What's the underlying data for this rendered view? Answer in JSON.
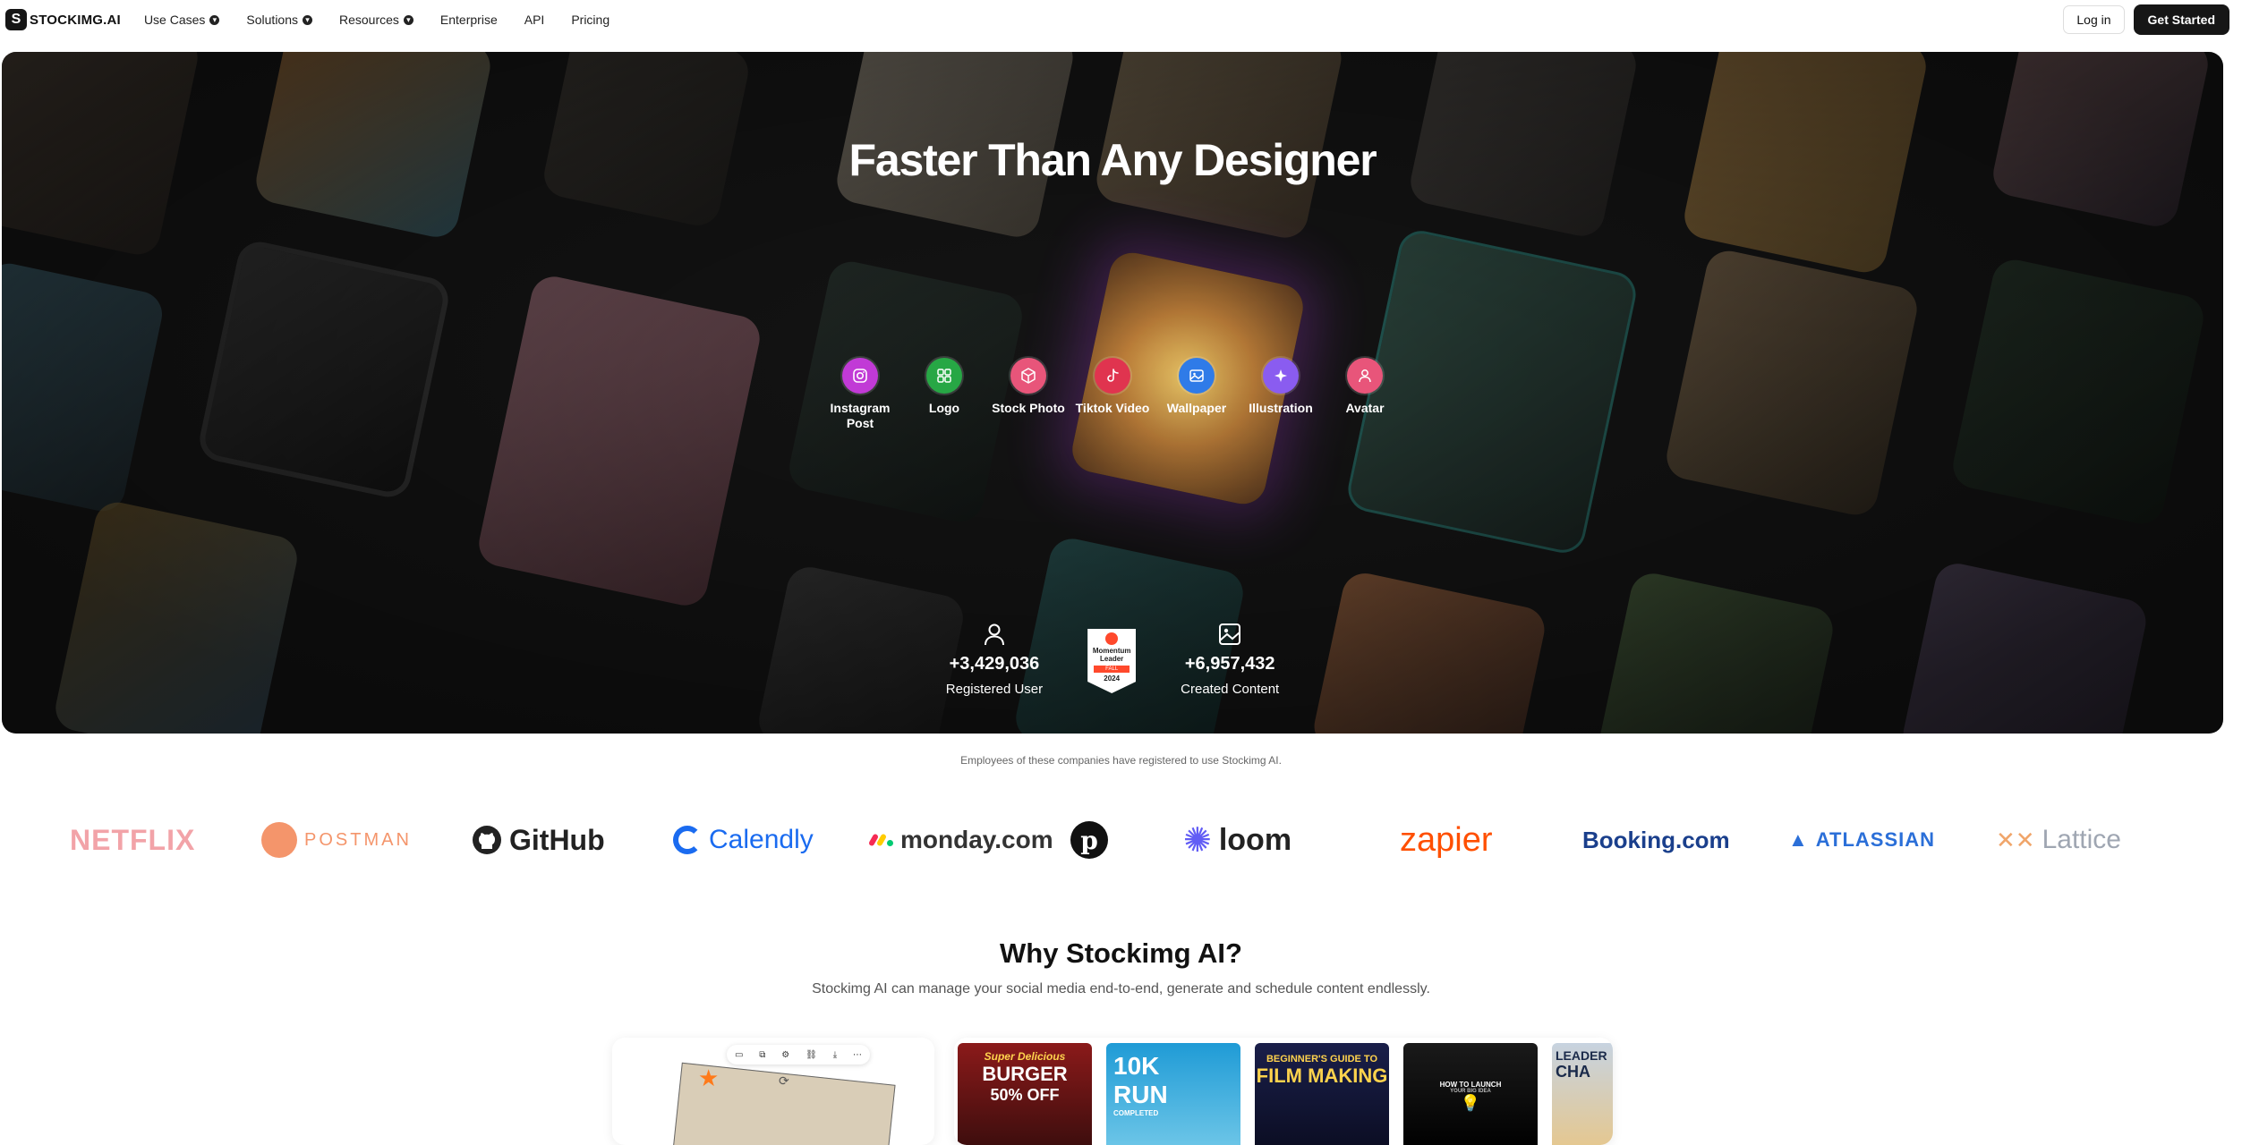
{
  "nav": {
    "logo_text": "STOCKIMG.AI",
    "logo_mark": "S",
    "items": [
      {
        "label": "Use Cases",
        "has_dropdown": true
      },
      {
        "label": "Solutions",
        "has_dropdown": true
      },
      {
        "label": "Resources",
        "has_dropdown": true
      },
      {
        "label": "Enterprise",
        "has_dropdown": false
      },
      {
        "label": "API",
        "has_dropdown": false
      },
      {
        "label": "Pricing",
        "has_dropdown": false
      }
    ],
    "login_label": "Log in",
    "cta_label": "Get Started"
  },
  "hero": {
    "title": "Faster Than Any Designer",
    "categories": [
      {
        "label": "Instagram Post",
        "icon": "instagram-icon",
        "color": "#c13ad6"
      },
      {
        "label": "Logo",
        "icon": "grid-icon",
        "color": "#27a745"
      },
      {
        "label": "Stock Photo",
        "icon": "box-icon",
        "color": "#e8557a"
      },
      {
        "label": "Tiktok Video",
        "icon": "tiktok-icon",
        "color": "#e0344f"
      },
      {
        "label": "Wallpaper",
        "icon": "image-icon",
        "color": "#2f7be8"
      },
      {
        "label": "Illustration",
        "icon": "sparkle-icon",
        "color": "#8a5cf0"
      },
      {
        "label": "Avatar",
        "icon": "user-icon",
        "color": "#e8557a"
      }
    ],
    "stats": {
      "users_value": "+3,429,036",
      "users_label": "Registered User",
      "content_value": "+6,957,432",
      "content_label": "Created Content",
      "badge_text": "Momentum Leader",
      "badge_season": "FALL",
      "badge_year": "2024"
    }
  },
  "companies": {
    "note": "Employees of these companies have registered to use Stockimg AI.",
    "logos": [
      "NETFLIX",
      "POSTMAN",
      "GitHub",
      "Calendly",
      "monday.com",
      "loom",
      "zapier",
      "Booking.com",
      "ATLASSIAN",
      "Lattice"
    ]
  },
  "why": {
    "title": "Why Stockimg AI?",
    "subtitle": "Stockimg AI can manage your social media end-to-end, generate and schedule content endlessly.",
    "thumbs": [
      {
        "line1": "Super Delicious",
        "line2": "BURGER",
        "line3": "50% OFF"
      },
      {
        "line1": "10K",
        "line2": "RUN",
        "line3": "COMPLETED"
      },
      {
        "line1": "BEGINNER'S GUIDE TO",
        "line2": "FILM MAKING",
        "line3": ""
      },
      {
        "line1": "HOW TO LAUNCH",
        "line2": "YOUR BIG IDEA",
        "line3": ""
      },
      {
        "line1": "LEADER",
        "line2": "CHA",
        "line3": ""
      }
    ]
  }
}
